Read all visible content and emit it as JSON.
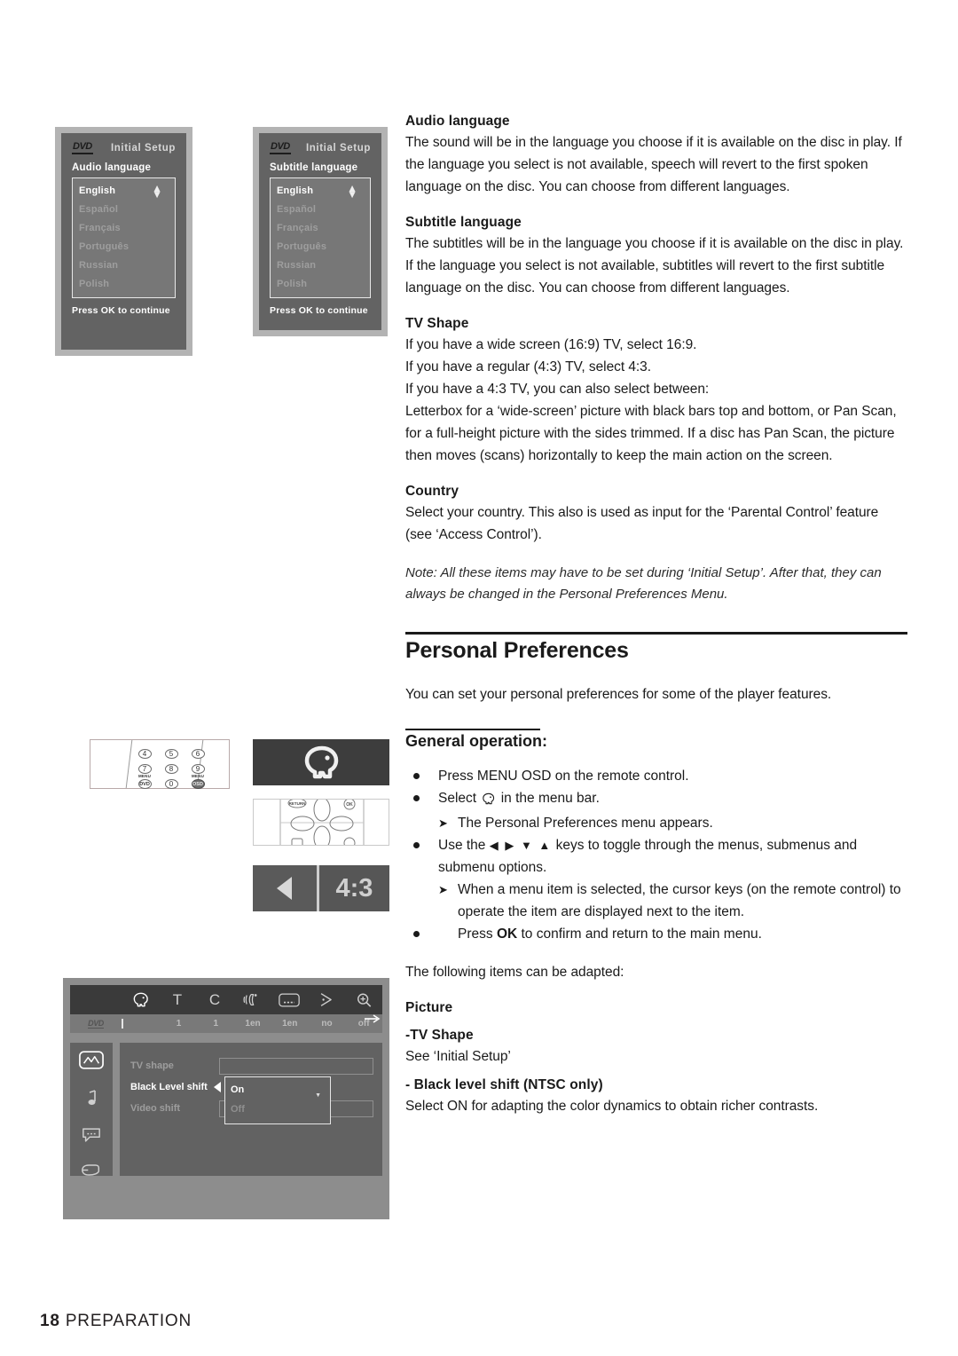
{
  "page": {
    "number": "18",
    "section": "PREPARATION"
  },
  "setup_screens": [
    {
      "logo": "DVD",
      "mode_label": "Initial Setup",
      "title": "Audio language",
      "options": [
        "English",
        "Español",
        "Français",
        "Português",
        "Russian",
        "Polish"
      ],
      "selected": "English",
      "footer": "Press OK to continue"
    },
    {
      "logo": "DVD",
      "mode_label": "Initial Setup",
      "title": "Subtitle language",
      "options": [
        "English",
        "Español",
        "Français",
        "Português",
        "Russian",
        "Polish"
      ],
      "selected": "English",
      "footer": "Press OK to continue"
    }
  ],
  "keypad": {
    "keys_row1": [
      "4",
      "5",
      "6"
    ],
    "keys_row2": [
      "7",
      "8",
      "9"
    ],
    "keys_row3_left_cap": "MENU",
    "keys_row3_left": "DVD",
    "keys_row3_mid": "0",
    "keys_row3_right_cap": "MENU",
    "keys_row3_right": "OSD"
  },
  "aspect_illustration": {
    "label": "4:3"
  },
  "osd": {
    "logo": "DVD",
    "menu_icons": [
      "face-icon",
      "title-icon",
      "chapter-icon",
      "audio-icon",
      "subtitle-icon",
      "angle-icon",
      "zoom-icon"
    ],
    "menu_values": [
      "",
      "1",
      "1",
      "1en",
      "1en",
      "no",
      "off"
    ],
    "sidebar_icons": [
      "picture-icon",
      "sound-icon",
      "language-icon",
      "features-icon"
    ],
    "rows": [
      {
        "label": "TV shape",
        "selected": false
      },
      {
        "label": "Black Level shift",
        "selected": true
      },
      {
        "label": "Video shift",
        "selected": false
      }
    ],
    "dropdown": {
      "selected": "On",
      "other": "Off"
    }
  },
  "content": {
    "audio_language": {
      "heading": "Audio language",
      "body": "The sound will be in the language you choose if it is available on the disc in play. If the language you select is not available, speech will revert to the first spoken language on the disc. You can choose from different languages."
    },
    "subtitle_language": {
      "heading": "Subtitle language",
      "body": "The subtitles will be in the language you choose if it is available on the disc in play. If the language you select is not available, subtitles will revert to the first subtitle language on the disc. You can choose from different languages."
    },
    "tv_shape": {
      "heading": "TV Shape",
      "line1": "If you have a wide screen (16:9) TV, select 16:9.",
      "line2": "If you have a regular (4:3) TV, select 4:3.",
      "line3": "If you have a 4:3 TV, you can also select between:",
      "body": "Letterbox for a ‘wide-screen’ picture with black bars top and bottom, or Pan Scan, for a full-height picture with the sides trimmed. If a disc has Pan Scan, the picture then moves (scans) horizontally to keep the main action on the screen."
    },
    "country": {
      "heading": "Country",
      "body": "Select your country. This also is used as input for the ‘Parental Control’ feature (see ‘Access Control’)."
    },
    "note": "Note: All these items may have to be set during ‘Initial Setup’. After that, they can always be changed in the Personal Preferences Menu.",
    "personal_preferences": {
      "heading": "Personal Preferences",
      "intro": "You can set your personal preferences for some of the player features."
    },
    "general_operation": {
      "heading": "General operation:",
      "bullet1": "Press MENU OSD on the remote control.",
      "bullet2_pre": "Select",
      "bullet2_post": "in the menu bar.",
      "sub1": "The Personal Preferences menu appears.",
      "bullet3_pre": "Use the",
      "bullet3_keys": "◀ ▶ ▼ ▲",
      "bullet3_post": "keys to toggle through the menus, submenus and submenu options.",
      "sub2": "When a menu item is selected, the cursor keys (on the remote control) to operate the item are displayed next to the item.",
      "bullet4_pre": "Press",
      "bullet4_ok": "OK",
      "bullet4_post": "to confirm and return to the main menu.",
      "closing": "The following items can be adapted:"
    },
    "picture": {
      "heading": "Picture",
      "tv_shape_heading": "-TV Shape",
      "tv_shape_body": "See ‘Initial Setup’",
      "black_level_heading": "- Black level shift (NTSC only)",
      "black_level_body": "Select ON for adapting the color dynamics to obtain richer contrasts."
    }
  }
}
